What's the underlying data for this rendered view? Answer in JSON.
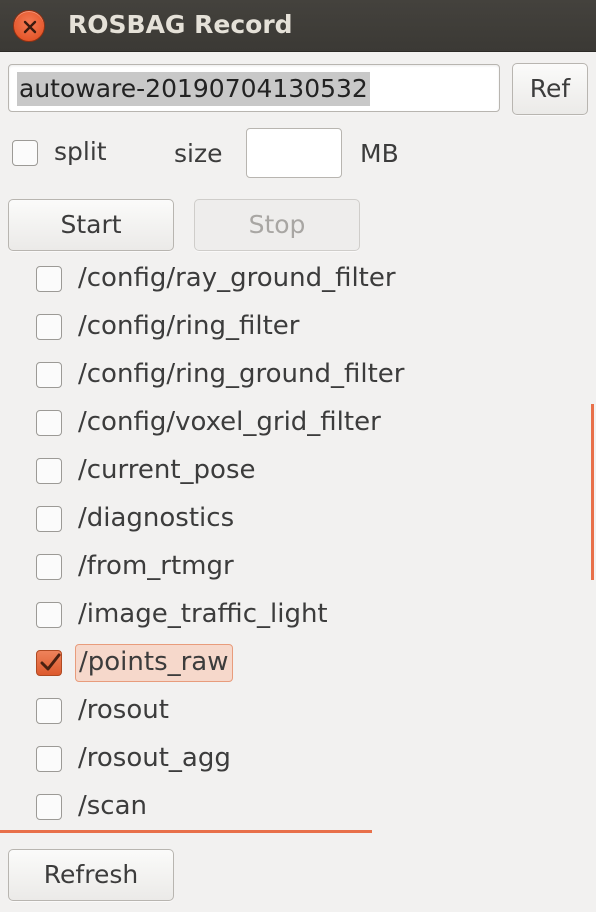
{
  "window": {
    "title": "ROSBAG Record"
  },
  "filename": {
    "value": "autoware-20190704130532"
  },
  "buttons": {
    "ref": "Ref",
    "start": "Start",
    "stop": "Stop",
    "refresh": "Refresh"
  },
  "split": {
    "label": "split",
    "checked": false,
    "size_label": "size",
    "size_value": "",
    "unit": "MB"
  },
  "topics": [
    {
      "name": "/config/ray_ground_filter",
      "checked": false
    },
    {
      "name": "/config/ring_filter",
      "checked": false
    },
    {
      "name": "/config/ring_ground_filter",
      "checked": false
    },
    {
      "name": "/config/voxel_grid_filter",
      "checked": false
    },
    {
      "name": "/current_pose",
      "checked": false
    },
    {
      "name": "/diagnostics",
      "checked": false
    },
    {
      "name": "/from_rtmgr",
      "checked": false
    },
    {
      "name": "/image_traffic_light",
      "checked": false
    },
    {
      "name": "/points_raw",
      "checked": true
    },
    {
      "name": "/rosout",
      "checked": false
    },
    {
      "name": "/rosout_agg",
      "checked": false
    },
    {
      "name": "/scan",
      "checked": false
    }
  ],
  "colors": {
    "accent": "#e8704a",
    "titlebar": "#3d3b37",
    "close": "#e8592b"
  }
}
